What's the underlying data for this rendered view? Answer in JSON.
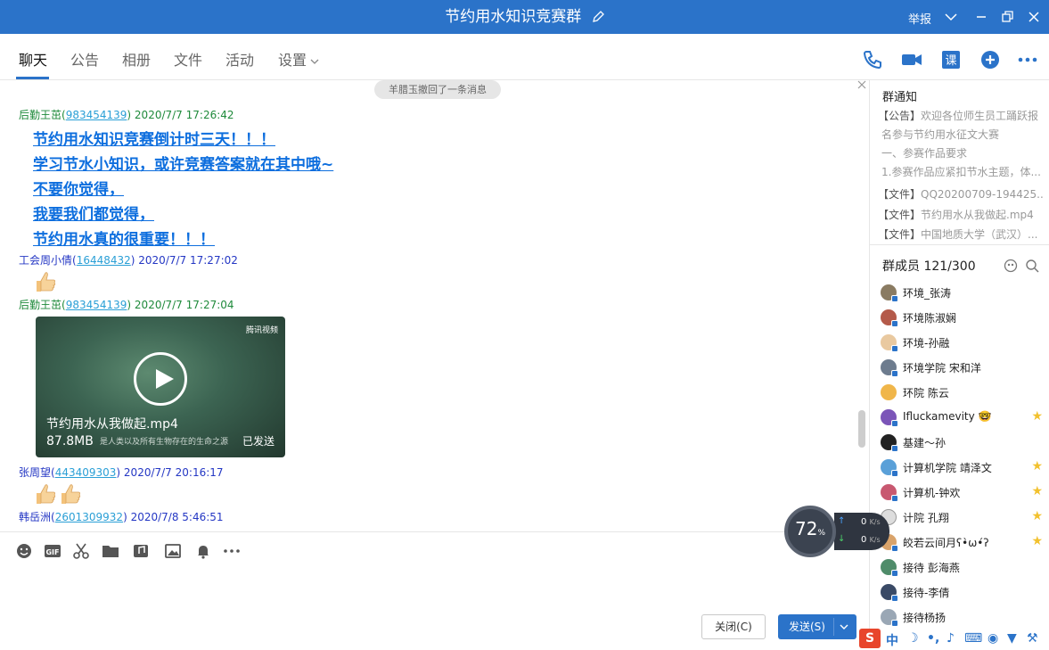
{
  "window": {
    "title": "节约用水知识竞赛群",
    "report": "举报"
  },
  "tabs": [
    {
      "label": "聊天"
    },
    {
      "label": "公告"
    },
    {
      "label": "相册"
    },
    {
      "label": "文件"
    },
    {
      "label": "活动"
    },
    {
      "label": "设置"
    }
  ],
  "chat": {
    "recall_notice": "羊腊玉撤回了一条消息",
    "msg1": {
      "sender": "后勤王茁",
      "qq": "983454139",
      "time": "2020/7/7 17:26:42"
    },
    "big_lines": [
      "节约用水知识竞赛倒计时三天！！！",
      "学习节水小知识，或许竞赛答案就在其中哦~",
      "不要你觉得，",
      "我要我们都觉得，",
      "节约用水真的很重要！！！"
    ],
    "msg2": {
      "sender": "工会周小倩",
      "qq": "16448432",
      "time": "2020/7/7 17:27:02"
    },
    "msg3": {
      "sender": "后勤王茁",
      "qq": "983454139",
      "time": "2020/7/7 17:27:04"
    },
    "video": {
      "filename": "节约用水从我做起.mp4",
      "size": "87.8MB",
      "subtitle": "是人类以及所有生物存在的生命之源",
      "status": "已发送",
      "logo": "腾讯视频"
    },
    "msg4": {
      "sender": "张周望",
      "qq": "443409303",
      "time": "2020/7/7 20:16:17"
    },
    "msg5": {
      "sender": "韩岳洲",
      "qq": "2601309932",
      "time": "2020/7/8 5:46:51"
    }
  },
  "input": {
    "close_label": "关闭(C)",
    "send_label": "发送(S)"
  },
  "sidebar": {
    "notice_title": "群通知",
    "notices": [
      {
        "tag": "【公告】",
        "text": "欢迎各位师生员工踊跃报"
      },
      {
        "tag": "",
        "text": "名参与节约用水征文大赛"
      },
      {
        "tag": "",
        "text": "一、参赛作品要求"
      },
      {
        "tag": "",
        "text": "1.参赛作品应紧扣节水主题，体..."
      },
      {
        "tag": "【文件】",
        "text": "QQ20200709-194425..."
      },
      {
        "tag": "【文件】",
        "text": "节约用水从我做起.mp4"
      },
      {
        "tag": "【文件】",
        "text": "中国地质大学（武汉）..."
      }
    ],
    "members_title": "群成员 121/300",
    "members": [
      {
        "name": "环境_张涛",
        "star": ""
      },
      {
        "name": "环境陈淑娴",
        "star": ""
      },
      {
        "name": "环境-孙融",
        "star": ""
      },
      {
        "name": "环境学院 宋和洋",
        "star": ""
      },
      {
        "name": "环院 陈云",
        "star": ""
      },
      {
        "name": "Ifluckamevity 🤓",
        "star": "★"
      },
      {
        "name": "基建～孙",
        "star": ""
      },
      {
        "name": "计算机学院 靖泽文",
        "star": "★"
      },
      {
        "name": "计算机-钟欢",
        "star": "★"
      },
      {
        "name": "计院 孔翔",
        "star": "★"
      },
      {
        "name": "皎若云间月ʕ•̀ω•́ʔ",
        "star": "★"
      },
      {
        "name": "接待 彭海燕",
        "star": ""
      },
      {
        "name": "接待-李倩",
        "star": ""
      },
      {
        "name": "接待杨扬",
        "star": ""
      }
    ]
  },
  "speed_widget": {
    "percent": "72",
    "unit": "%",
    "up": "0",
    "down": "0",
    "rate_unit": "K/s"
  },
  "ime": {
    "label_s": "S",
    "label_zh": "中"
  },
  "colors": {
    "titlebar": "#2b73c9",
    "link_blue": "#0d6ede",
    "sender_green": "#1f8a3b",
    "sender_blue": "#2437c4"
  }
}
